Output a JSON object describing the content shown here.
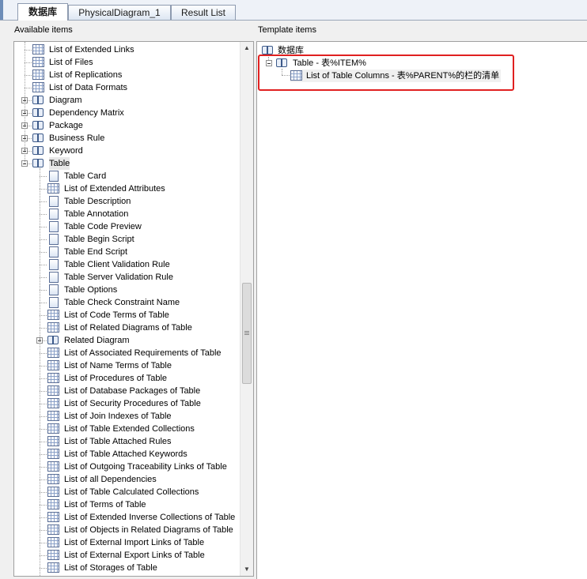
{
  "tabs": [
    {
      "label": "数据库",
      "active": true
    },
    {
      "label": "PhysicalDiagram_1",
      "active": false
    },
    {
      "label": "Result List",
      "active": false
    }
  ],
  "left_panel": {
    "title": "Available items",
    "items": [
      {
        "label": "List of Extended Links",
        "icon": "grid-icon"
      },
      {
        "label": "List of Files",
        "icon": "grid-icon"
      },
      {
        "label": "List of Replications",
        "icon": "grid-icon"
      },
      {
        "label": "List of Data Formats",
        "icon": "grid-icon"
      },
      {
        "label": "Diagram",
        "icon": "book-icon",
        "expander": "plus"
      },
      {
        "label": "Dependency Matrix",
        "icon": "book-icon",
        "expander": "plus"
      },
      {
        "label": "Package",
        "icon": "book-icon",
        "expander": "plus"
      },
      {
        "label": "Business Rule",
        "icon": "book-icon",
        "expander": "plus"
      },
      {
        "label": "Keyword",
        "icon": "book-icon",
        "expander": "plus"
      },
      {
        "label": "Table",
        "icon": "book-icon",
        "expander": "minus"
      },
      {
        "label": "Table Card",
        "icon": "document-icon"
      },
      {
        "label": "List of Extended Attributes",
        "icon": "grid-icon"
      },
      {
        "label": "Table Description",
        "icon": "document-icon"
      },
      {
        "label": "Table Annotation",
        "icon": "document-icon"
      },
      {
        "label": "Table Code Preview",
        "icon": "document-icon"
      },
      {
        "label": "Table Begin Script",
        "icon": "document-icon"
      },
      {
        "label": "Table End Script",
        "icon": "document-icon"
      },
      {
        "label": "Table Client Validation Rule",
        "icon": "document-icon"
      },
      {
        "label": "Table Server Validation Rule",
        "icon": "document-icon"
      },
      {
        "label": "Table Options",
        "icon": "document-icon"
      },
      {
        "label": "Table Check Constraint Name",
        "icon": "document-icon"
      },
      {
        "label": "List of Code Terms of Table",
        "icon": "grid-icon"
      },
      {
        "label": "List of Related Diagrams of Table",
        "icon": "grid-icon"
      },
      {
        "label": "Related Diagram",
        "icon": "book-icon",
        "expander": "plus"
      },
      {
        "label": "List of Associated Requirements of Table",
        "icon": "grid-icon"
      },
      {
        "label": "List of Name Terms of Table",
        "icon": "grid-icon"
      },
      {
        "label": "List of Procedures of Table",
        "icon": "grid-icon"
      },
      {
        "label": "List of Database Packages of Table",
        "icon": "grid-icon"
      },
      {
        "label": "List of Security Procedures of Table",
        "icon": "grid-icon"
      },
      {
        "label": "List of Join Indexes of Table",
        "icon": "grid-icon"
      },
      {
        "label": "List of Table Extended Collections",
        "icon": "grid-icon"
      },
      {
        "label": "List of Table Attached Rules",
        "icon": "grid-icon"
      },
      {
        "label": "List of Table Attached Keywords",
        "icon": "grid-icon"
      },
      {
        "label": "List of Outgoing Traceability Links of Table",
        "icon": "grid-icon"
      },
      {
        "label": "List of all Dependencies",
        "icon": "grid-icon"
      },
      {
        "label": "List of Table Calculated Collections",
        "icon": "grid-icon"
      },
      {
        "label": "List of Terms of Table",
        "icon": "grid-icon"
      },
      {
        "label": "List of Extended Inverse Collections of Table",
        "icon": "grid-icon"
      },
      {
        "label": "List of Objects in Related Diagrams of Table",
        "icon": "grid-icon"
      },
      {
        "label": "List of External Import Links of Table",
        "icon": "grid-icon"
      },
      {
        "label": "List of External Export Links of Table",
        "icon": "grid-icon"
      },
      {
        "label": "List of Storages of Table",
        "icon": "grid-icon"
      }
    ]
  },
  "right_panel": {
    "title": "Template items",
    "root": "数据库",
    "table_node": "Table - 表%ITEM%",
    "columns_node": "List of Table Columns - 表%PARENT%的栏的清单"
  },
  "colors": {
    "highlight_border": "#e02020",
    "tab_border": "#8e9bb0",
    "panel_background": "#ffffff"
  }
}
